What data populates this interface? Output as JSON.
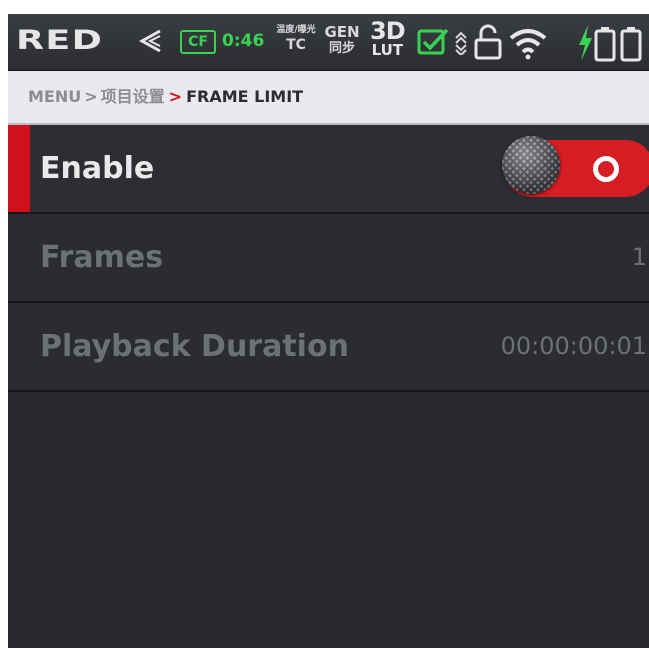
{
  "top_crop_text": "",
  "status": {
    "brand": "RED",
    "media_type": "CF",
    "media_time": "0:46",
    "tc_top": "温度/曝光",
    "tc_label": "TC",
    "gen_label": "GEN",
    "gen_sub": "同步",
    "lut_top": "3D",
    "lut_bottom": "LUT",
    "icons": [
      "chevron-left-icon",
      "check-box-icon",
      "arrows-icon",
      "lock-open-icon",
      "wifi-icon",
      "power-bolt-icon",
      "battery-icon",
      "battery-icon"
    ],
    "accent_green": "#39d353"
  },
  "breadcrumb": {
    "root": "MENU",
    "separator": ">",
    "middle": "项目设置",
    "current": "FRAME LIMIT"
  },
  "menu": {
    "items": [
      {
        "label": "Enable",
        "value": "",
        "toggle_on": true
      },
      {
        "label": "Frames",
        "value": "1"
      },
      {
        "label": "Playback Duration",
        "value": "00:00:00:01"
      }
    ]
  },
  "colors": {
    "accent_red": "#d0101a",
    "background": "#26282c"
  }
}
